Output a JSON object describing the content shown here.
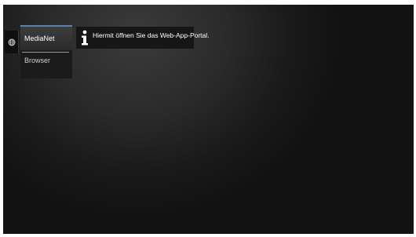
{
  "sidebar": {
    "globe_icon": "globe-icon"
  },
  "menu": {
    "items": [
      {
        "label": "MediaNet",
        "active": true
      },
      {
        "label": "Browser",
        "active": false
      }
    ],
    "accent_color": "#5c82a8"
  },
  "tooltip": {
    "icon": "info-icon",
    "text": "Hiermit öffnen Sie das Web-App-Portal."
  }
}
